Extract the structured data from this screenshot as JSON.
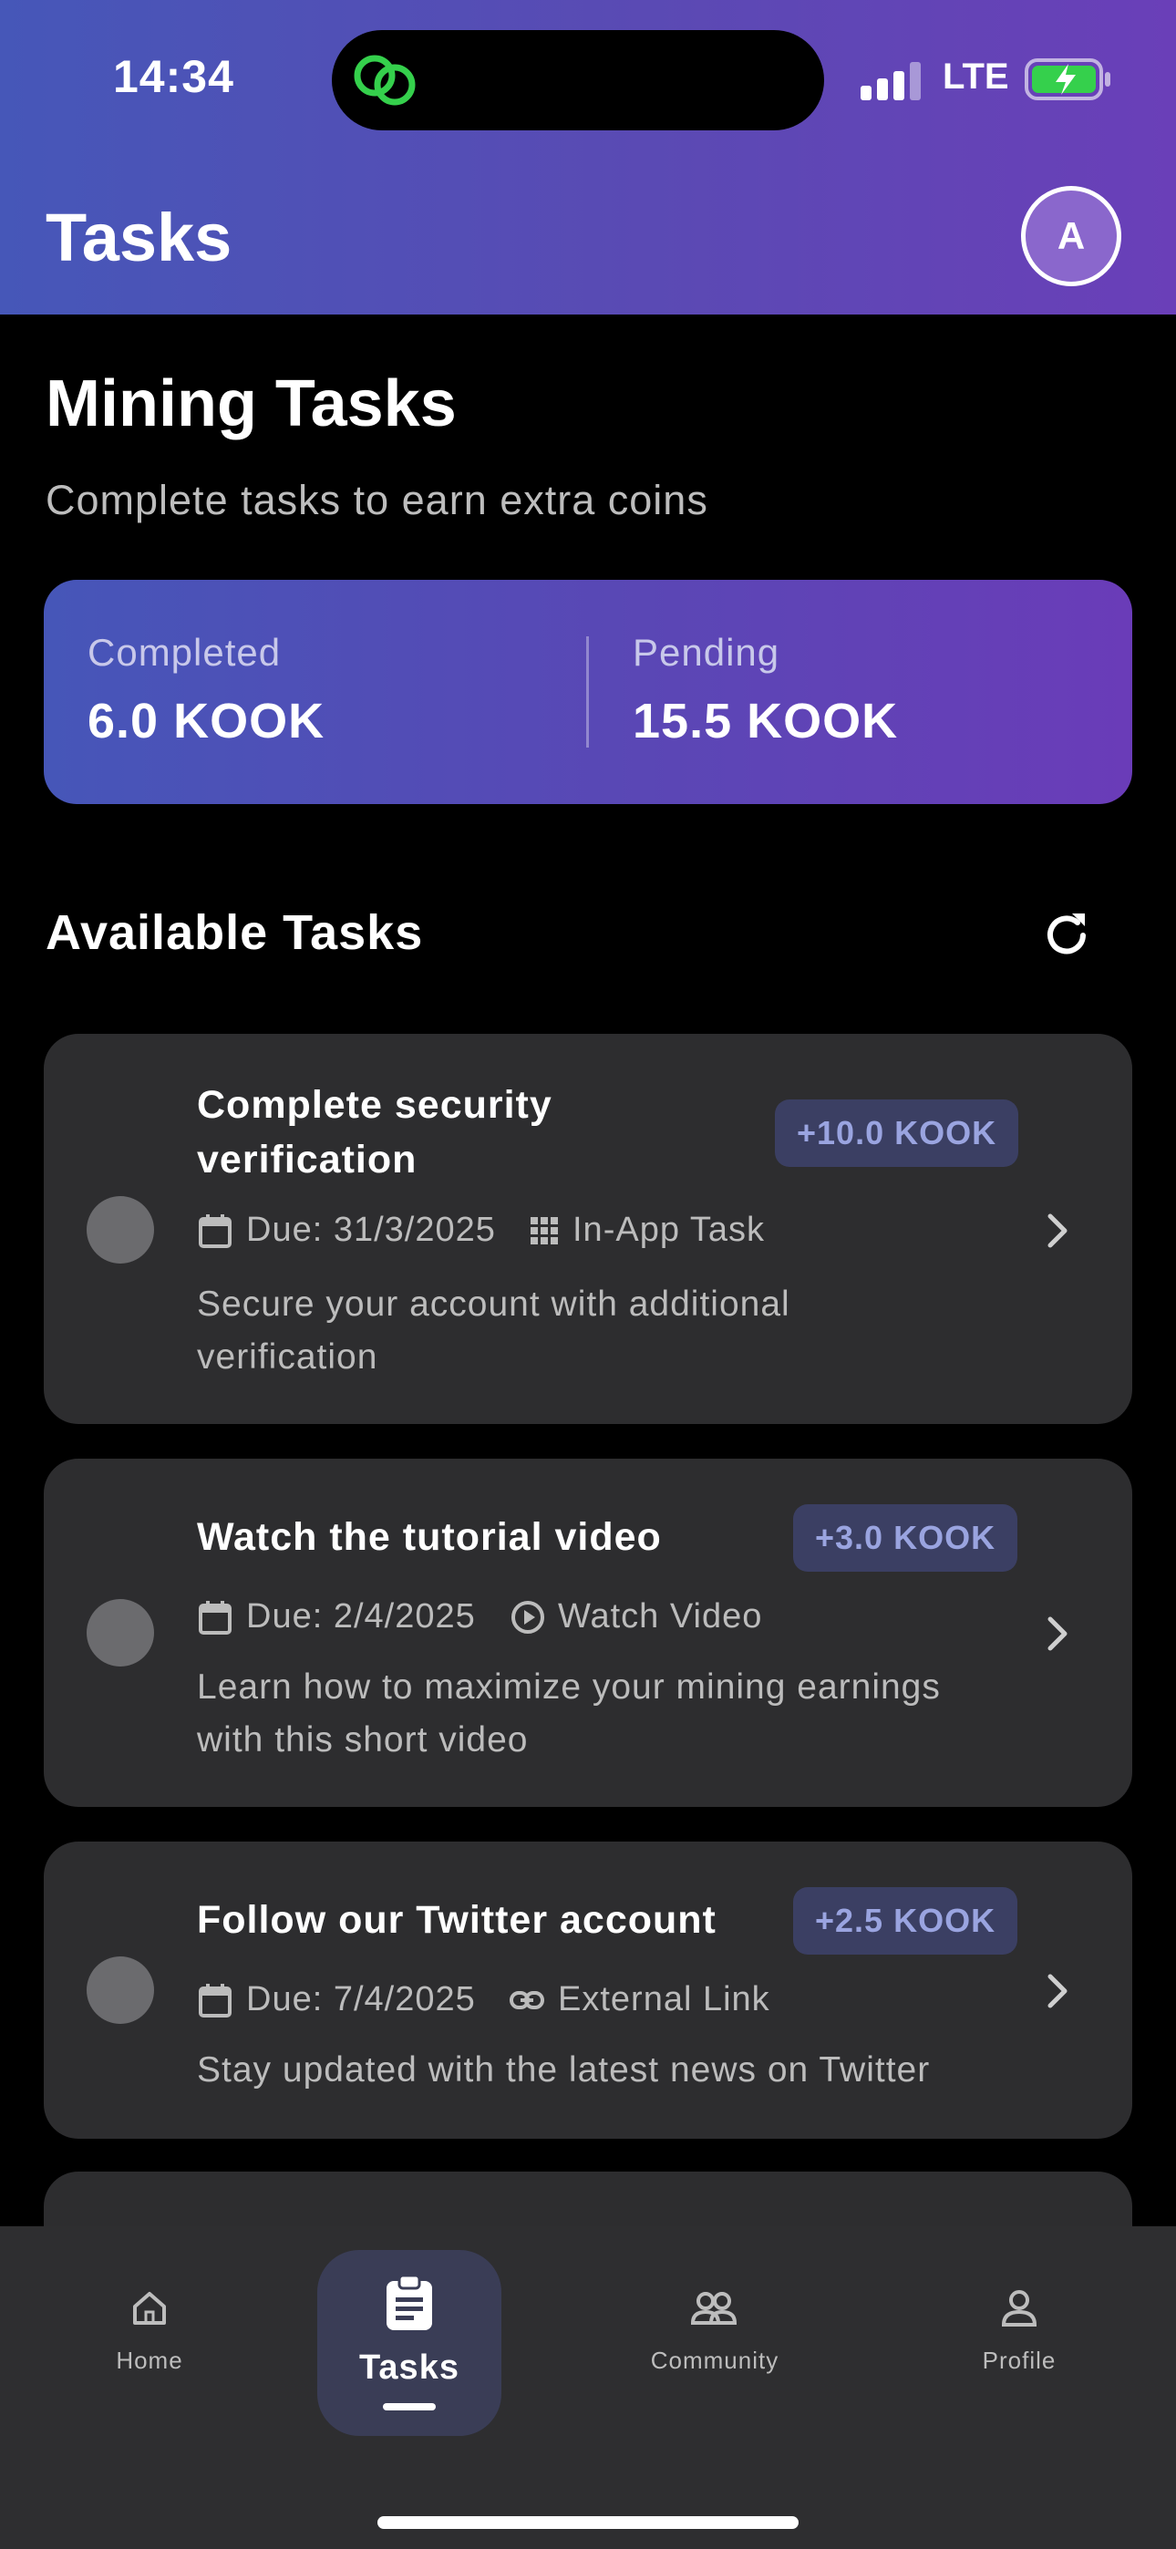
{
  "status_bar": {
    "time": "14:34",
    "network": "LTE"
  },
  "header": {
    "title": "Tasks",
    "avatar_letter": "A"
  },
  "section": {
    "title": "Mining Tasks",
    "subtitle": "Complete tasks to earn extra coins"
  },
  "stats": {
    "completed_label": "Completed",
    "completed_value": "6.0 KOOK",
    "pending_label": "Pending",
    "pending_value": "15.5 KOOK"
  },
  "available": {
    "title": "Available Tasks"
  },
  "tasks": [
    {
      "title_line1": "Complete security",
      "title_line2": "verification",
      "reward": "+10.0 KOOK",
      "due": "Due: 31/3/2025",
      "type": "In-App Task",
      "type_icon": "grid-icon",
      "desc_line1": "Secure your account with additional",
      "desc_line2": "verification"
    },
    {
      "title_line1": "Watch the tutorial video",
      "reward": "+3.0 KOOK",
      "due": "Due: 2/4/2025",
      "type": "Watch Video",
      "type_icon": "play-circle-icon",
      "desc_line1": "Learn how to maximize your mining earnings",
      "desc_line2": "with this short video"
    },
    {
      "title_line1": "Follow our Twitter account",
      "reward": "+2.5 KOOK",
      "due": "Due: 7/4/2025",
      "type": "External Link",
      "type_icon": "link-icon",
      "desc_line1": "Stay updated with the latest news on Twitter"
    }
  ],
  "nav": {
    "home": "Home",
    "tasks": "Tasks",
    "community": "Community",
    "profile": "Profile"
  },
  "colors": {
    "header_gradient_start": "#4657b8",
    "header_gradient_end": "#6a3fb8",
    "card_bg": "#2d2d2f",
    "badge_bg": "#3b3f63",
    "badge_text": "#9aa4e0"
  }
}
